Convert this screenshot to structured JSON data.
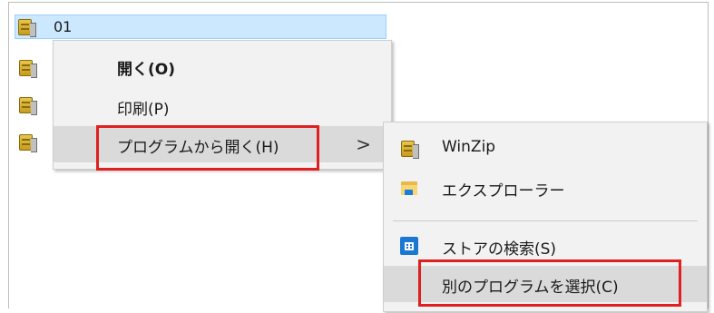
{
  "files": [
    {
      "name": "01",
      "selected": true
    },
    {
      "name": "",
      "selected": false
    },
    {
      "name": "",
      "selected": false
    },
    {
      "name": "",
      "selected": false
    }
  ],
  "context_menu": {
    "open": "開く(O)",
    "print": "印刷(P)",
    "open_with": "プログラムから開く(H)",
    "submenu_arrow": ">"
  },
  "submenu": {
    "winzip": "WinZip",
    "explorer": "エクスプローラー",
    "store_search": "ストアの検索(S)",
    "choose_program": "別のプログラムを選択(C)"
  },
  "colors": {
    "selection_bg": "#cce8ff",
    "menu_bg": "#f2f2f2",
    "hover_bg": "#dadada",
    "highlight_box": "#e02020"
  },
  "icons": {
    "archive": "winzip-archive-icon",
    "explorer": "folder-icon",
    "store": "store-icon",
    "arrow": "chevron-right-icon"
  }
}
